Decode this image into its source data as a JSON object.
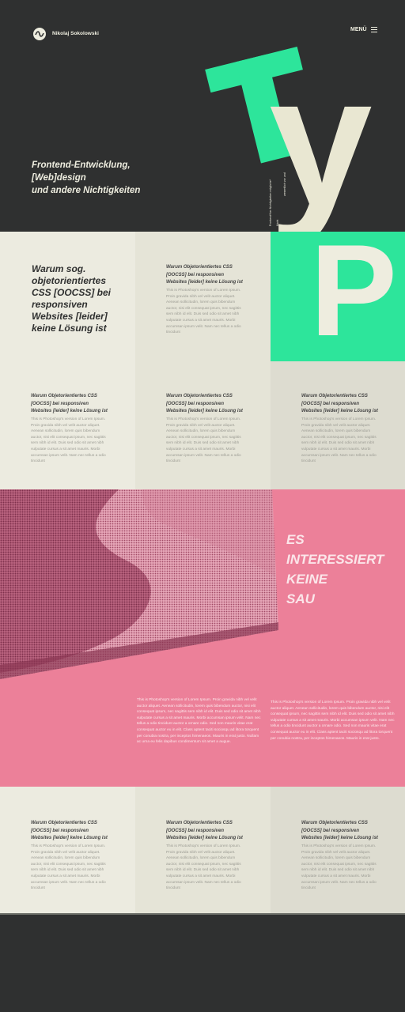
{
  "header": {
    "author": "Nikolaj Sokolowski",
    "menu_label": "MENÜ",
    "tagline": [
      "Frontend-Entwicklung,",
      "[Web]design",
      "und andere Nichtigkeiten"
    ],
    "hero_letters": [
      "T",
      "y"
    ],
    "vertical_text": [
      "Frontend*ker Nichtigkeiten mögliche*",
      "Nicht",
      "wesentlich vor und"
    ]
  },
  "section1": {
    "intro": "Warum sog. objetorientiertes CSS [OOCSS] bei responsiven Websites [leider] keine Lösung ist",
    "card": {
      "title": "Warum Objetorientiertes CSS [OOCSS] bei responsiven Websites [leider] keine Lösung ist",
      "body": "This is Photoshop's version of Lorem Ipsum. Proin gravida nibh vel velit auctor aliquet. Aenean sollicitudin, lorem quis bibendum auctor, nisi elit consequat ipsum, nec sagittis sem nibh id elit. Duis sed odio sit amet nibh vulputate cursus a sit amet mauris. Morbi accumsan ipsum velit. Nam nec tellus a odio tincidunt"
    },
    "feature_letter": "P"
  },
  "section2": {
    "cards": [
      {
        "title": "Warum Objetorientiertes CSS [OOCSS] bei responsiven Websites [leider] keine Lösung ist",
        "body": "This is Photoshop's version of Lorem Ipsum. Proin gravida nibh vel velit auctor aliquet. Aenean sollicitudin, lorem quis bibendum auctor, nisi elit consequat ipsum, nec sagittis sem nibh id elit. Duis sed odio sit amet nibh vulputate cursus a sit amet mauris. Morbi accumsan ipsum velit. Nam nec tellus a odio tincidunt"
      },
      {
        "title": "Warum Objetorientiertes CSS [OOCSS] bei responsiven Websites [leider] keine Lösung ist",
        "body": "This is Photoshop's version of Lorem Ipsum. Proin gravida nibh vel velit auctor aliquet. Aenean sollicitudin, lorem quis bibendum auctor, nisi elit consequat ipsum, nec sagittis sem nibh id elit. Duis sed odio sit amet nibh vulputate cursus a sit amet mauris. Morbi accumsan ipsum velit. Nam nec tellus a odio tincidunt"
      },
      {
        "title": "Warum Objetorientiertes CSS [OOCSS] bei responsiven Websites [leider] keine Lösung ist",
        "body": "This is Photoshop's version of Lorem Ipsum. Proin gravida nibh vel velit auctor aliquet. Aenean sollicitudin, lorem quis bibendum auctor, nisi elit consequat ipsum, nec sagittis sem nibh id elit. Duis sed odio sit amet nibh vulputate cursus a sit amet mauris. Morbi accumsan ipsum velit. Nam nec tellus a odio tincidunt"
      }
    ]
  },
  "feature": {
    "headline": [
      "ES",
      "INTERESSIERT",
      "KEINE",
      "SAU"
    ],
    "body_left": "This is Photoshop's version of Lorem Ipsum. Proin gravida nibh vel velit auctor aliquet. Aenean sollicitudin, lorem quis bibendum auctor, nisi elit consequat ipsum, nec sagittis sem nibh id elit. Duis sed odio sit amet nibh vulputate cursus a sit amet mauris. Morbi accumsan ipsum velit. Nam nec tellus a odio tincidunt auctor a ornare odio. Sed non mauris vitae erat consequat auctor eu in elit. Class aptent taciti sociosqu ad litora torquent per conubia nostra, per inceptos himenaeos. Mauris in erat justo. Nullam ac urna eu felis dapibus condimentum sit amet a augue.",
    "body_right": "This is Photoshop's version of Lorem Ipsum. Proin gravida nibh vel velit auctor aliquet. Aenean sollicitudin, lorem quis bibendum auctor, nisi elit consequat ipsum, nec sagittis sem nibh id elit. Duis sed odio sit amet nibh vulputate cursus a sit amet mauris. Morbi accumsan ipsum velit. Nam nec tellus a odio tincidunt auctor a ornare odio. Sed non mauris vitae erat consequat auctor eu in elit. Class aptent taciti sociosqu ad litora torquent per conubia nostra, per inceptos himenaeos. Mauris in erat justo."
  },
  "section3": {
    "cards": [
      {
        "title": "Warum Objetorientiertes CSS [OOCSS] bei responsiven Websites [leider] keine Lösung ist",
        "body": "This is Photoshop's version of Lorem Ipsum. Proin gravida nibh vel velit auctor aliquet. Aenean sollicitudin, lorem quis bibendum auctor, nisi elit consequat ipsum, nec sagittis sem nibh id elit. Duis sed odio sit amet nibh vulputate cursus a sit amet mauris. Morbi accumsan ipsum velit. Nam nec tellus a odio tincidunt"
      },
      {
        "title": "Warum Objetorientiertes CSS [OOCSS] bei responsiven Websites [leider] keine Lösung ist",
        "body": "This is Photoshop's version of Lorem Ipsum. Proin gravida nibh vel velit auctor aliquet. Aenean sollicitudin, lorem quis bibendum auctor, nisi elit consequat ipsum, nec sagittis sem nibh id elit. Duis sed odio sit amet nibh vulputate cursus a sit amet mauris. Morbi accumsan ipsum velit. Nam nec tellus a odio tincidunt"
      },
      {
        "title": "Warum Objetorientiertes CSS [OOCSS] bei responsiven Websites [leider] keine Lösung ist",
        "body": "This is Photoshop's version of Lorem Ipsum. Proin gravida nibh vel velit auctor aliquet. Aenean sollicitudin, lorem quis bibendum auctor, nisi elit consequat ipsum, nec sagittis sem nibh id elit. Duis sed odio sit amet nibh vulputate cursus a sit amet mauris. Morbi accumsan ipsum velit. Nam nec tellus a odio tincidunt"
      }
    ]
  },
  "colors": {
    "dark": "#2f3030",
    "green": "#2de59b",
    "cream": "#eeeddf",
    "pink": "#ec8099"
  },
  "icons": {
    "logo": "wave-logo-icon",
    "menu": "hamburger-menu-icon"
  }
}
